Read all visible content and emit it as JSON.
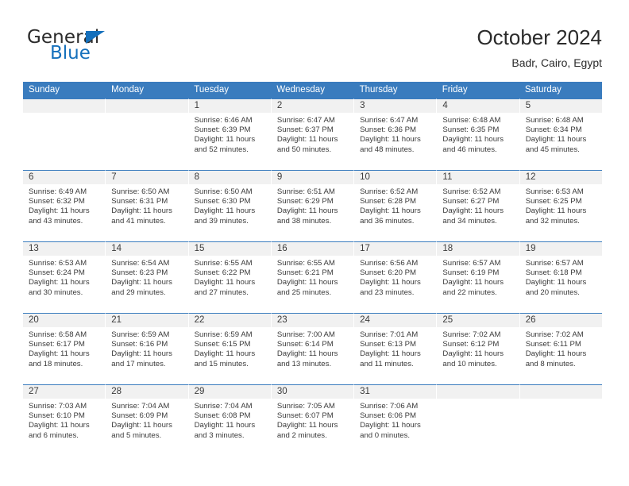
{
  "brand": {
    "name_part1": "General",
    "name_part2": "Blue",
    "triangle_color": "#1570bc"
  },
  "header": {
    "title": "October 2024",
    "subtitle": "Badr, Cairo, Egypt",
    "accent_color": "#3a7cbe",
    "daynum_band_color": "#f1f1f1"
  },
  "weekdays": [
    "Sunday",
    "Monday",
    "Tuesday",
    "Wednesday",
    "Thursday",
    "Friday",
    "Saturday"
  ],
  "weeks": [
    [
      {
        "day": "",
        "sunrise": "",
        "sunset": "",
        "daylight_line1": "",
        "daylight_line2": ""
      },
      {
        "day": "",
        "sunrise": "",
        "sunset": "",
        "daylight_line1": "",
        "daylight_line2": ""
      },
      {
        "day": "1",
        "sunrise": "Sunrise: 6:46 AM",
        "sunset": "Sunset: 6:39 PM",
        "daylight_line1": "Daylight: 11 hours",
        "daylight_line2": "and 52 minutes."
      },
      {
        "day": "2",
        "sunrise": "Sunrise: 6:47 AM",
        "sunset": "Sunset: 6:37 PM",
        "daylight_line1": "Daylight: 11 hours",
        "daylight_line2": "and 50 minutes."
      },
      {
        "day": "3",
        "sunrise": "Sunrise: 6:47 AM",
        "sunset": "Sunset: 6:36 PM",
        "daylight_line1": "Daylight: 11 hours",
        "daylight_line2": "and 48 minutes."
      },
      {
        "day": "4",
        "sunrise": "Sunrise: 6:48 AM",
        "sunset": "Sunset: 6:35 PM",
        "daylight_line1": "Daylight: 11 hours",
        "daylight_line2": "and 46 minutes."
      },
      {
        "day": "5",
        "sunrise": "Sunrise: 6:48 AM",
        "sunset": "Sunset: 6:34 PM",
        "daylight_line1": "Daylight: 11 hours",
        "daylight_line2": "and 45 minutes."
      }
    ],
    [
      {
        "day": "6",
        "sunrise": "Sunrise: 6:49 AM",
        "sunset": "Sunset: 6:32 PM",
        "daylight_line1": "Daylight: 11 hours",
        "daylight_line2": "and 43 minutes."
      },
      {
        "day": "7",
        "sunrise": "Sunrise: 6:50 AM",
        "sunset": "Sunset: 6:31 PM",
        "daylight_line1": "Daylight: 11 hours",
        "daylight_line2": "and 41 minutes."
      },
      {
        "day": "8",
        "sunrise": "Sunrise: 6:50 AM",
        "sunset": "Sunset: 6:30 PM",
        "daylight_line1": "Daylight: 11 hours",
        "daylight_line2": "and 39 minutes."
      },
      {
        "day": "9",
        "sunrise": "Sunrise: 6:51 AM",
        "sunset": "Sunset: 6:29 PM",
        "daylight_line1": "Daylight: 11 hours",
        "daylight_line2": "and 38 minutes."
      },
      {
        "day": "10",
        "sunrise": "Sunrise: 6:52 AM",
        "sunset": "Sunset: 6:28 PM",
        "daylight_line1": "Daylight: 11 hours",
        "daylight_line2": "and 36 minutes."
      },
      {
        "day": "11",
        "sunrise": "Sunrise: 6:52 AM",
        "sunset": "Sunset: 6:27 PM",
        "daylight_line1": "Daylight: 11 hours",
        "daylight_line2": "and 34 minutes."
      },
      {
        "day": "12",
        "sunrise": "Sunrise: 6:53 AM",
        "sunset": "Sunset: 6:25 PM",
        "daylight_line1": "Daylight: 11 hours",
        "daylight_line2": "and 32 minutes."
      }
    ],
    [
      {
        "day": "13",
        "sunrise": "Sunrise: 6:53 AM",
        "sunset": "Sunset: 6:24 PM",
        "daylight_line1": "Daylight: 11 hours",
        "daylight_line2": "and 30 minutes."
      },
      {
        "day": "14",
        "sunrise": "Sunrise: 6:54 AM",
        "sunset": "Sunset: 6:23 PM",
        "daylight_line1": "Daylight: 11 hours",
        "daylight_line2": "and 29 minutes."
      },
      {
        "day": "15",
        "sunrise": "Sunrise: 6:55 AM",
        "sunset": "Sunset: 6:22 PM",
        "daylight_line1": "Daylight: 11 hours",
        "daylight_line2": "and 27 minutes."
      },
      {
        "day": "16",
        "sunrise": "Sunrise: 6:55 AM",
        "sunset": "Sunset: 6:21 PM",
        "daylight_line1": "Daylight: 11 hours",
        "daylight_line2": "and 25 minutes."
      },
      {
        "day": "17",
        "sunrise": "Sunrise: 6:56 AM",
        "sunset": "Sunset: 6:20 PM",
        "daylight_line1": "Daylight: 11 hours",
        "daylight_line2": "and 23 minutes."
      },
      {
        "day": "18",
        "sunrise": "Sunrise: 6:57 AM",
        "sunset": "Sunset: 6:19 PM",
        "daylight_line1": "Daylight: 11 hours",
        "daylight_line2": "and 22 minutes."
      },
      {
        "day": "19",
        "sunrise": "Sunrise: 6:57 AM",
        "sunset": "Sunset: 6:18 PM",
        "daylight_line1": "Daylight: 11 hours",
        "daylight_line2": "and 20 minutes."
      }
    ],
    [
      {
        "day": "20",
        "sunrise": "Sunrise: 6:58 AM",
        "sunset": "Sunset: 6:17 PM",
        "daylight_line1": "Daylight: 11 hours",
        "daylight_line2": "and 18 minutes."
      },
      {
        "day": "21",
        "sunrise": "Sunrise: 6:59 AM",
        "sunset": "Sunset: 6:16 PM",
        "daylight_line1": "Daylight: 11 hours",
        "daylight_line2": "and 17 minutes."
      },
      {
        "day": "22",
        "sunrise": "Sunrise: 6:59 AM",
        "sunset": "Sunset: 6:15 PM",
        "daylight_line1": "Daylight: 11 hours",
        "daylight_line2": "and 15 minutes."
      },
      {
        "day": "23",
        "sunrise": "Sunrise: 7:00 AM",
        "sunset": "Sunset: 6:14 PM",
        "daylight_line1": "Daylight: 11 hours",
        "daylight_line2": "and 13 minutes."
      },
      {
        "day": "24",
        "sunrise": "Sunrise: 7:01 AM",
        "sunset": "Sunset: 6:13 PM",
        "daylight_line1": "Daylight: 11 hours",
        "daylight_line2": "and 11 minutes."
      },
      {
        "day": "25",
        "sunrise": "Sunrise: 7:02 AM",
        "sunset": "Sunset: 6:12 PM",
        "daylight_line1": "Daylight: 11 hours",
        "daylight_line2": "and 10 minutes."
      },
      {
        "day": "26",
        "sunrise": "Sunrise: 7:02 AM",
        "sunset": "Sunset: 6:11 PM",
        "daylight_line1": "Daylight: 11 hours",
        "daylight_line2": "and 8 minutes."
      }
    ],
    [
      {
        "day": "27",
        "sunrise": "Sunrise: 7:03 AM",
        "sunset": "Sunset: 6:10 PM",
        "daylight_line1": "Daylight: 11 hours",
        "daylight_line2": "and 6 minutes."
      },
      {
        "day": "28",
        "sunrise": "Sunrise: 7:04 AM",
        "sunset": "Sunset: 6:09 PM",
        "daylight_line1": "Daylight: 11 hours",
        "daylight_line2": "and 5 minutes."
      },
      {
        "day": "29",
        "sunrise": "Sunrise: 7:04 AM",
        "sunset": "Sunset: 6:08 PM",
        "daylight_line1": "Daylight: 11 hours",
        "daylight_line2": "and 3 minutes."
      },
      {
        "day": "30",
        "sunrise": "Sunrise: 7:05 AM",
        "sunset": "Sunset: 6:07 PM",
        "daylight_line1": "Daylight: 11 hours",
        "daylight_line2": "and 2 minutes."
      },
      {
        "day": "31",
        "sunrise": "Sunrise: 7:06 AM",
        "sunset": "Sunset: 6:06 PM",
        "daylight_line1": "Daylight: 11 hours",
        "daylight_line2": "and 0 minutes."
      },
      {
        "day": "",
        "sunrise": "",
        "sunset": "",
        "daylight_line1": "",
        "daylight_line2": ""
      },
      {
        "day": "",
        "sunrise": "",
        "sunset": "",
        "daylight_line1": "",
        "daylight_line2": ""
      }
    ]
  ]
}
